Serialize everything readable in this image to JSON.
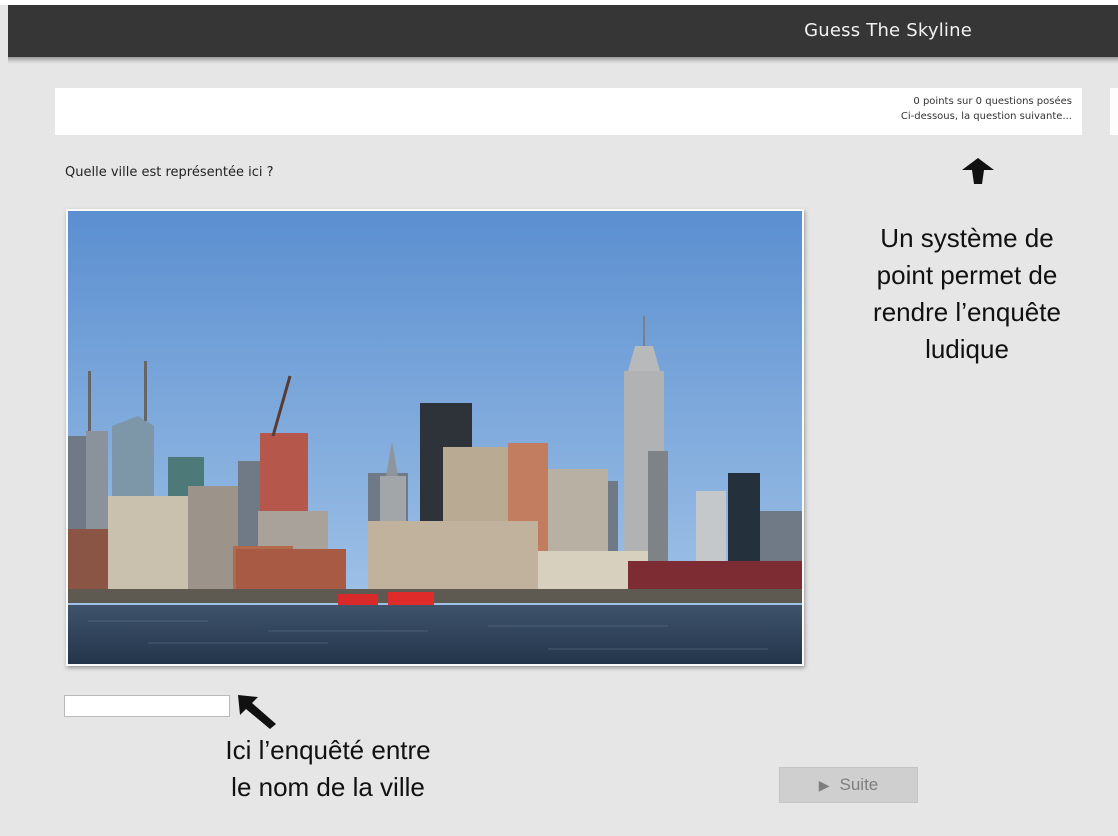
{
  "header": {
    "title": "Guess The Skyline"
  },
  "score_panel": {
    "score_line": "0 points sur 0 questions posées",
    "next_line": "Ci-dessous, la question suivante..."
  },
  "question": {
    "prompt": "Quelle ville est représentée ici ?",
    "answer_value": "",
    "answer_placeholder": ""
  },
  "annotations": {
    "score_note": [
      "Un système de",
      "point permet de",
      "rendre l’enquête",
      "ludique"
    ],
    "input_note": [
      "Ici l’enquêté entre",
      "le nom de la ville"
    ]
  },
  "next_button": {
    "icon": "play-icon",
    "label": "Suite"
  },
  "colors": {
    "header_bg": "#363636",
    "page_bg": "#e6e6e6",
    "button_bg": "#cfcfcf",
    "button_text": "#7e7e7e"
  }
}
